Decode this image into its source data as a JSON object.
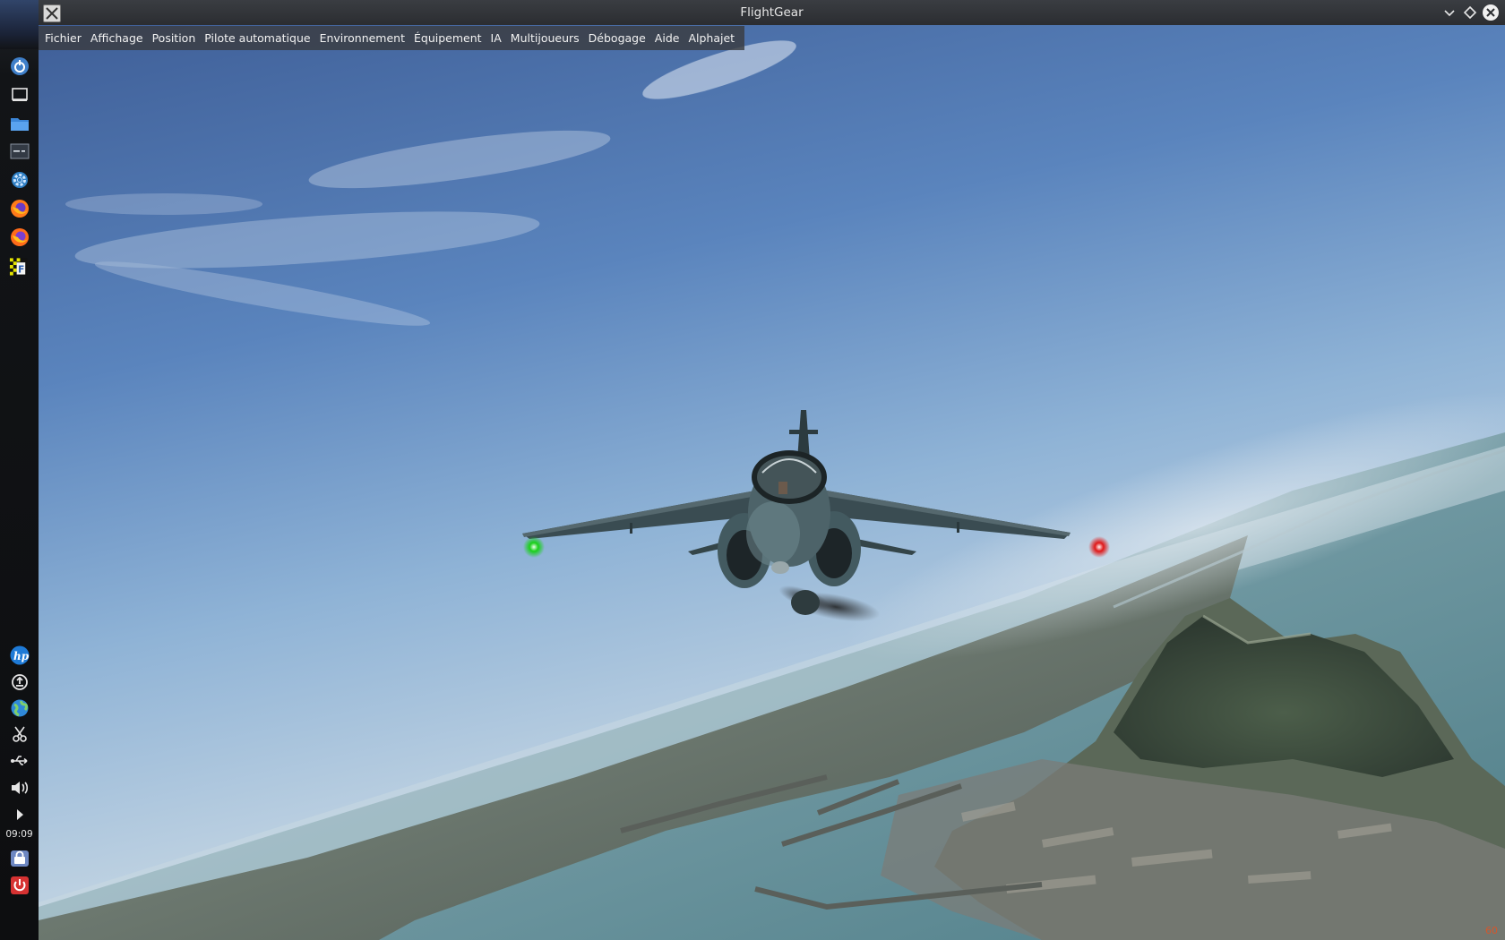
{
  "window": {
    "title": "FlightGear"
  },
  "menubar": {
    "items": [
      {
        "label": "Fichier"
      },
      {
        "label": "Affichage"
      },
      {
        "label": "Position"
      },
      {
        "label": "Pilote automatique"
      },
      {
        "label": "Environnement"
      },
      {
        "label": "Équipement"
      },
      {
        "label": "IA"
      },
      {
        "label": "Multijoueurs"
      },
      {
        "label": "Débogage"
      },
      {
        "label": "Aide"
      },
      {
        "label": "Alphajet"
      }
    ]
  },
  "taskbar": {
    "launchers": [
      {
        "icon": "app-menu-icon"
      },
      {
        "icon": "desktop-icon"
      },
      {
        "icon": "file-manager-icon"
      },
      {
        "icon": "terminal-icon"
      },
      {
        "icon": "settings-icon"
      },
      {
        "icon": "firefox-icon"
      },
      {
        "icon": "firefox-icon"
      },
      {
        "icon": "flightgear-icon"
      }
    ],
    "tray": [
      {
        "icon": "hp-icon"
      },
      {
        "icon": "update-icon"
      },
      {
        "icon": "network-globe-icon"
      },
      {
        "icon": "scissors-icon"
      },
      {
        "icon": "usb-icon"
      },
      {
        "icon": "volume-icon"
      },
      {
        "icon": "expand-arrow-icon"
      }
    ],
    "clock": "09:09",
    "bottom": [
      {
        "icon": "lock-screen-icon"
      },
      {
        "icon": "power-icon"
      }
    ]
  },
  "hud": {
    "fps": "60"
  },
  "colors": {
    "sky_top": "#4a6aa3",
    "sky_horizon": "#bccfe2",
    "sea": "#6f9aa3",
    "land": "#5c665c",
    "aircraft": "#3c4f55",
    "nav_left": "#18d018",
    "nav_right": "#e01818"
  }
}
